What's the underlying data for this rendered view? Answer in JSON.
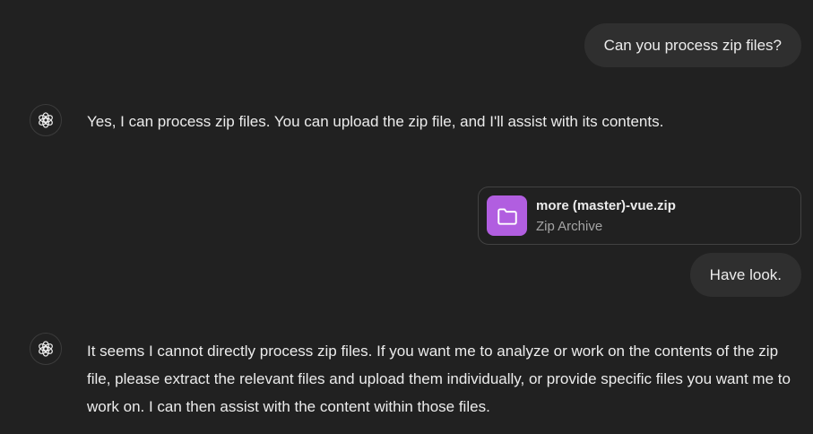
{
  "messages": {
    "user_1": "Can you process zip files?",
    "assistant_1": "Yes, I can process zip files. You can upload the zip file, and I'll assist with its contents.",
    "attachment": {
      "file_name": "more (master)-vue.zip",
      "file_type": "Zip Archive",
      "icon": "folder-icon",
      "icon_bg_color": "#b15ee0"
    },
    "user_2": "Have look.",
    "assistant_2": "It seems I cannot directly process zip files. If you want me to analyze or work on the contents of the zip file, please extract the relevant files and upload them individually, or provide specific files you want me to work on. I can then assist with the content within those files."
  },
  "theme": {
    "background": "#212121",
    "user_bubble": "#2f2f2f",
    "text": "#ececec"
  }
}
